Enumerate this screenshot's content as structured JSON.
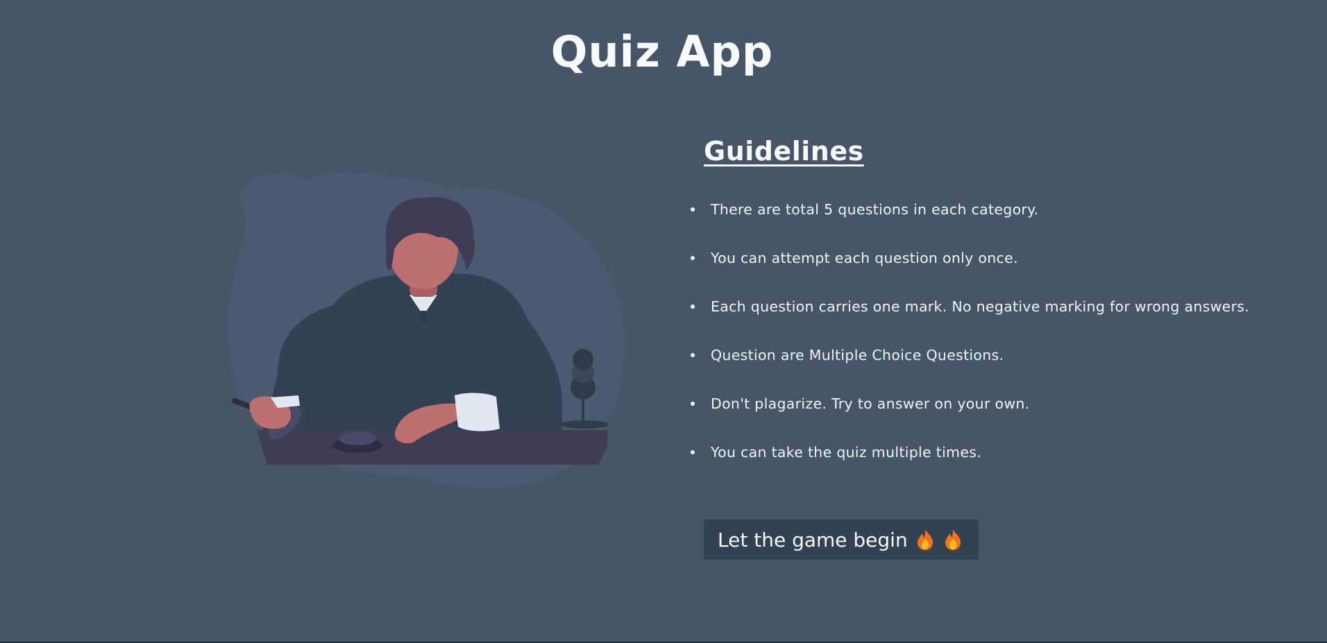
{
  "app": {
    "title": "Quiz App"
  },
  "guidelines": {
    "heading": "Guidelines",
    "rules": [
      "There are total 5 questions in each category.",
      "You can attempt each question only once.",
      "Each question carries one mark. No negative marking for wrong answers.",
      "Question are Multiple Choice Questions.",
      "Don't plagarize. Try to answer on your own.",
      "You can take the quiz multiple times."
    ]
  },
  "start_button": {
    "label": "Let the game begin",
    "icons": [
      "fire-icon",
      "fire-icon"
    ]
  },
  "illustration": {
    "icon": "person-at-desk-illustration"
  },
  "colors": {
    "background": "#475569",
    "button": "#334155",
    "text": "#f1f5f9",
    "skin": "#be6f6f",
    "suit": "#334155",
    "hair": "#3f3d56"
  }
}
